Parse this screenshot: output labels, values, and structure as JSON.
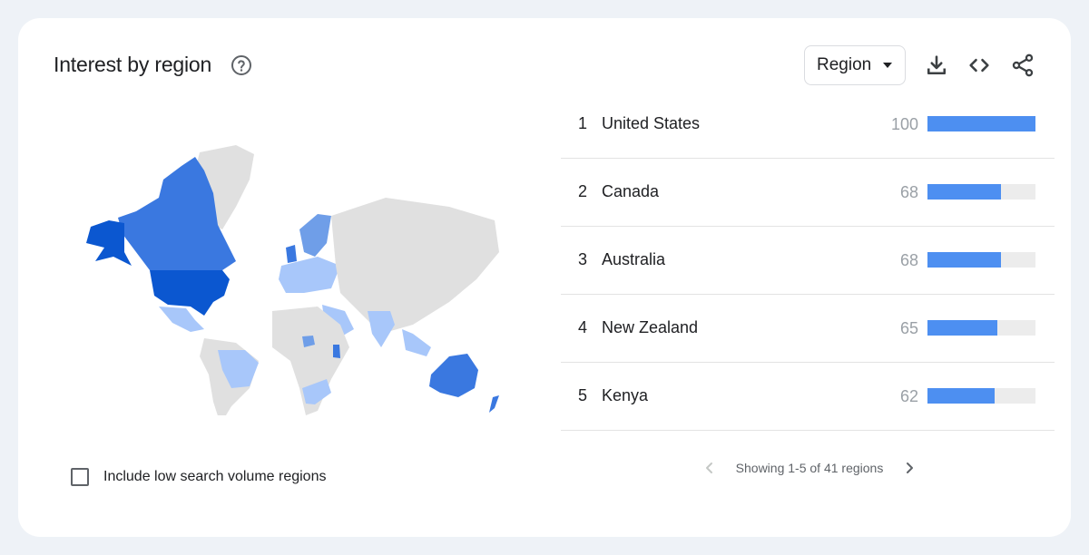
{
  "header": {
    "title": "Interest by region",
    "help_icon": "help-circle-icon"
  },
  "toolbar": {
    "region_select": {
      "selected": "Region"
    },
    "icons": [
      "download-icon",
      "embed-code-icon",
      "share-icon"
    ]
  },
  "map": {
    "description": "World choropleth map of search interest",
    "colors": {
      "highest": "#0b57d0",
      "high": "#3a78e0",
      "medium": "#6f9ee8",
      "low": "#a8c7fa",
      "none": "#e0e0e0"
    },
    "highlighted_regions": [
      {
        "name": "United States",
        "level": "highest"
      },
      {
        "name": "Canada",
        "level": "high"
      },
      {
        "name": "Australia",
        "level": "high"
      },
      {
        "name": "New Zealand",
        "level": "high"
      },
      {
        "name": "Kenya",
        "level": "high"
      },
      {
        "name": "Nigeria",
        "level": "medium"
      },
      {
        "name": "United Kingdom",
        "level": "medium"
      },
      {
        "name": "Scandinavia",
        "level": "medium"
      },
      {
        "name": "India",
        "level": "low"
      },
      {
        "name": "Brazil",
        "level": "low"
      },
      {
        "name": "South Africa",
        "level": "low"
      },
      {
        "name": "Mexico",
        "level": "low"
      },
      {
        "name": "Western Europe",
        "level": "low"
      },
      {
        "name": "Southeast Asia",
        "level": "low"
      },
      {
        "name": "Middle East",
        "level": "low"
      }
    ]
  },
  "options": {
    "low_volume_checkbox": {
      "label": "Include low search volume regions",
      "checked": false
    }
  },
  "regions": [
    {
      "rank": "1",
      "name": "United States",
      "value": "100",
      "fraction": 1.0
    },
    {
      "rank": "2",
      "name": "Canada",
      "value": "68",
      "fraction": 0.68
    },
    {
      "rank": "3",
      "name": "Australia",
      "value": "68",
      "fraction": 0.68
    },
    {
      "rank": "4",
      "name": "New Zealand",
      "value": "65",
      "fraction": 0.65
    },
    {
      "rank": "5",
      "name": "Kenya",
      "value": "62",
      "fraction": 0.62
    }
  ],
  "pagination": {
    "text": "Showing 1-5 of 41 regions",
    "prev_enabled": false,
    "next_enabled": true
  },
  "colors": {
    "bar_fill": "#4d8ff1",
    "bar_track": "#ececec",
    "value_text": "#9aa0a6"
  }
}
